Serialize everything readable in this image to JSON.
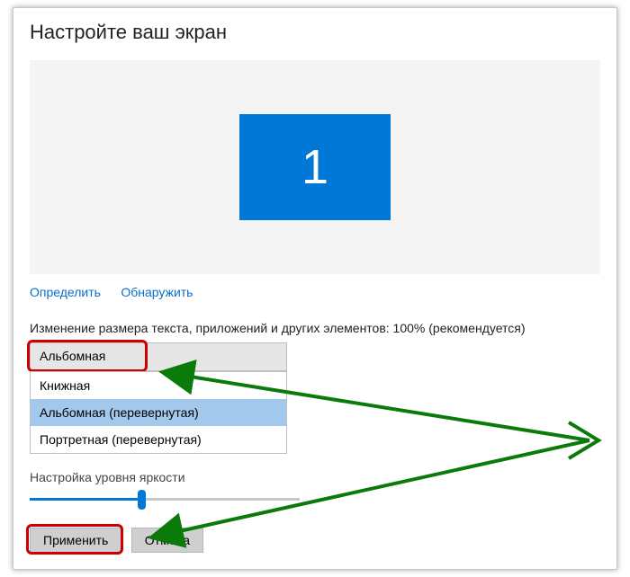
{
  "title": "Настройте ваш экран",
  "monitor": {
    "number": "1"
  },
  "links": {
    "identify": "Определить",
    "detect": "Обнаружить"
  },
  "scale_label": "Изменение размера текста, приложений и других элементов: 100% (рекомендуется)",
  "orientation": {
    "selected": "Альбомная",
    "options": [
      "Книжная",
      "Альбомная (перевернутая)",
      "Портретная (перевернутая)"
    ],
    "highlighted_index": 1
  },
  "brightness_label": "Настройка уровня яркости",
  "buttons": {
    "apply": "Применить",
    "cancel": "Отмена"
  }
}
